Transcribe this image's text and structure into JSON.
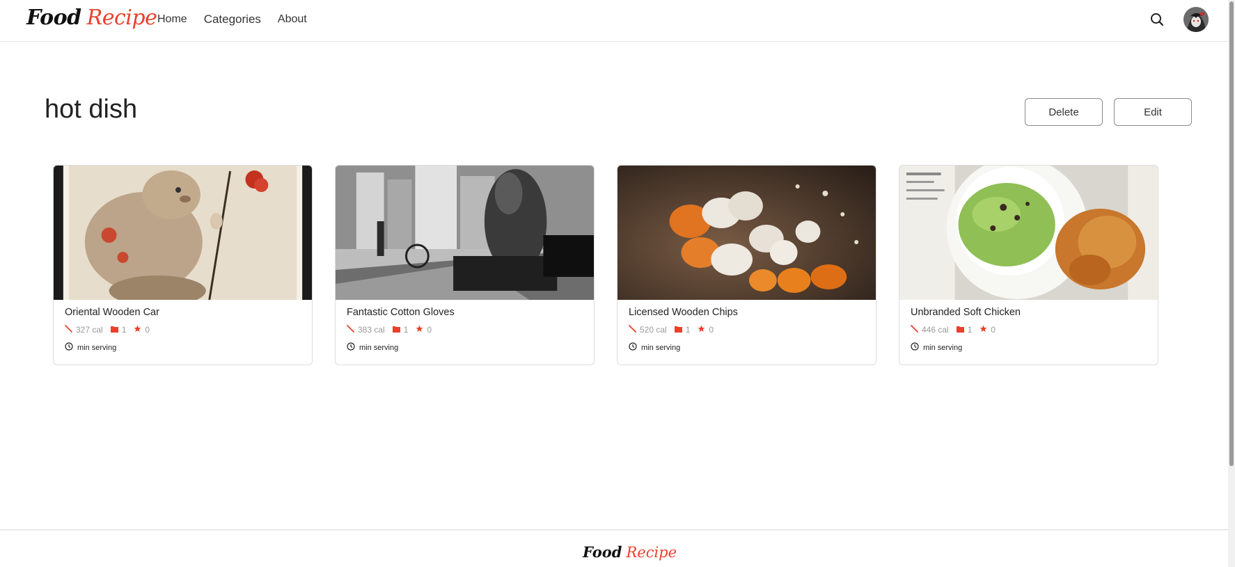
{
  "brand": {
    "word1": "Food",
    "word2": "Recipe",
    "accent_color": "#e8412c"
  },
  "nav": {
    "links": [
      "Home",
      "Categories",
      "About"
    ]
  },
  "header_icons": {
    "search": "search-icon",
    "avatar": "avatar"
  },
  "category": {
    "title": "hot dish",
    "delete_label": "Delete",
    "edit_label": "Edit"
  },
  "recipes": [
    {
      "title": "Oriental Wooden Car",
      "calories": "327 cal",
      "categories": "1",
      "rating": "0",
      "serving": "min serving",
      "image": "illustrated-beaver-image"
    },
    {
      "title": "Fantastic Cotton Gloves",
      "calories": "383 cal",
      "categories": "1",
      "rating": "0",
      "serving": "min serving",
      "image": "street-photo-image"
    },
    {
      "title": "Licensed Wooden Chips",
      "calories": "520 cal",
      "categories": "1",
      "rating": "0",
      "serving": "min serving",
      "image": "eggs-image"
    },
    {
      "title": "Unbranded Soft Chicken",
      "calories": "446 cal",
      "categories": "1",
      "rating": "0",
      "serving": "min serving",
      "image": "salad-fried-chicken-image"
    }
  ],
  "footer": {
    "word1": "Food",
    "word2": "Recipe"
  }
}
